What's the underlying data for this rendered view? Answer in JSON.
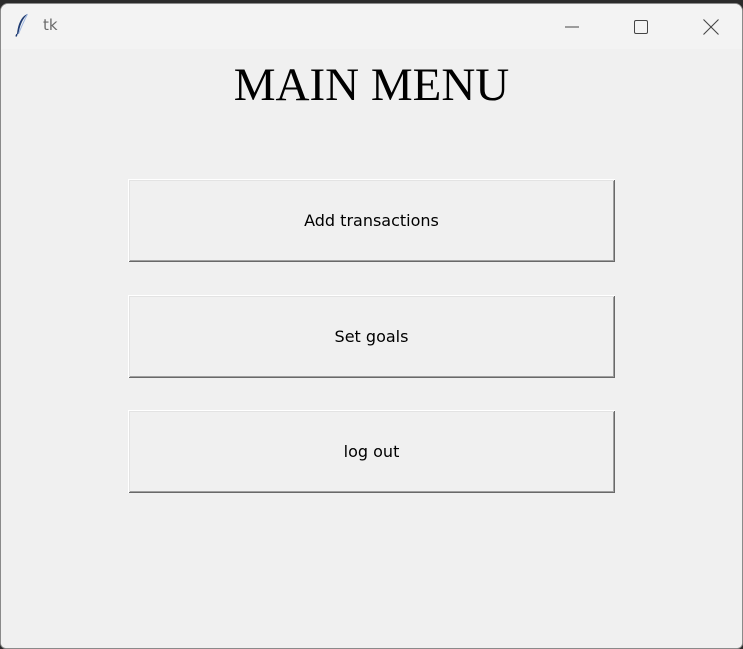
{
  "window": {
    "title": "tk",
    "icons": {
      "app": "tk-feather-icon",
      "minimize": "minimize-icon",
      "maximize": "maximize-icon",
      "close": "close-icon"
    }
  },
  "main": {
    "heading": "MAIN MENU",
    "buttons": {
      "add_transactions": "Add transactions",
      "set_goals": "Set goals",
      "log_out": "log out"
    }
  },
  "colors": {
    "background": "#f0f0f0",
    "titlebar": "#f3f3f3",
    "text": "#000000"
  }
}
